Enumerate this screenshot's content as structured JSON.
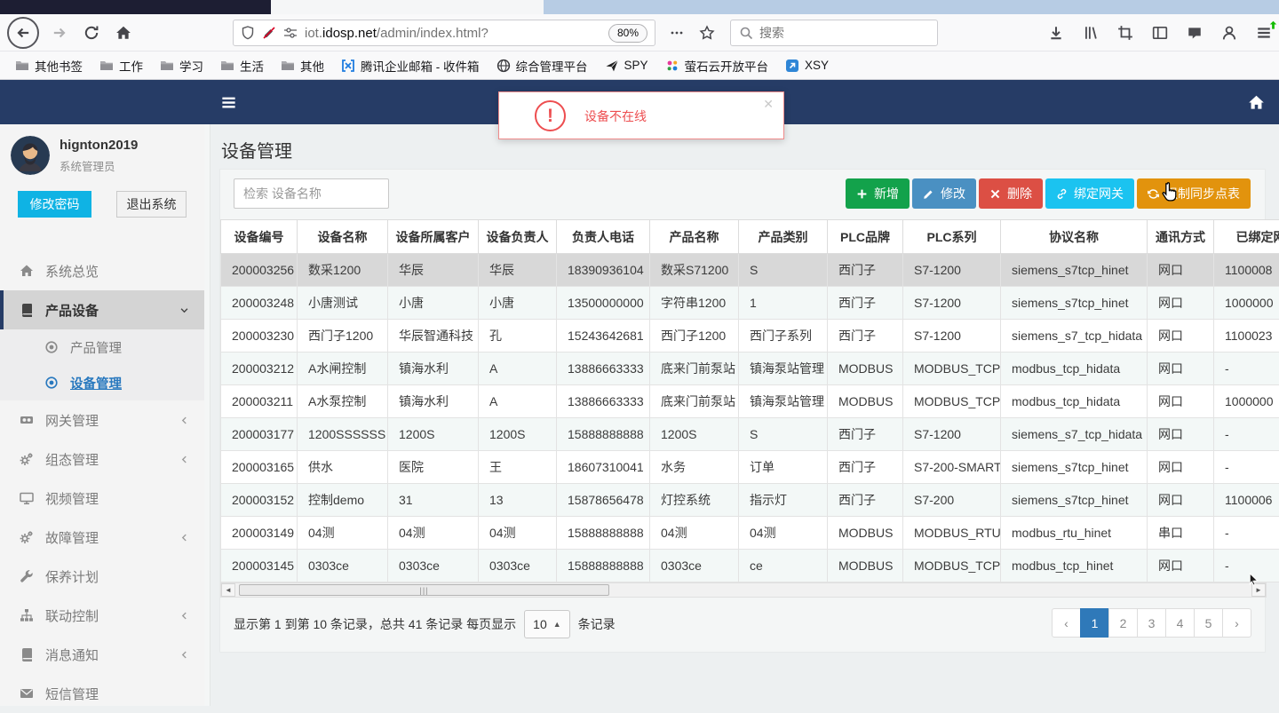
{
  "browser": {
    "toolbar": {
      "url_subdomain": "iot.",
      "url_domain": "idosp.net",
      "url_path": "/admin/index.html?",
      "zoom_badge": "80%",
      "search_placeholder": "搜索",
      "right_icons": [
        "download",
        "library",
        "screenshot",
        "sidebar",
        "pocket",
        "account",
        "menu"
      ]
    },
    "bookmarks": [
      {
        "icon": "folder",
        "label": "其他书签"
      },
      {
        "icon": "folder",
        "label": "工作"
      },
      {
        "icon": "folder",
        "label": "学习"
      },
      {
        "icon": "folder",
        "label": "生活"
      },
      {
        "icon": "folder",
        "label": "其他"
      },
      {
        "icon": "tencent-mail",
        "label": "腾讯企业邮箱 - 收件箱"
      },
      {
        "icon": "globe",
        "label": "综合管理平台"
      },
      {
        "icon": "plane",
        "label": "SPY"
      },
      {
        "icon": "color-dots",
        "label": "萤石云开放平台"
      },
      {
        "icon": "xsy",
        "label": "XSY"
      }
    ]
  },
  "app": {
    "alert": {
      "text": "设备不在线",
      "close": "✕",
      "accent_color": "#ED4E50"
    },
    "sidebar": {
      "user": {
        "name": "hignton2019",
        "role": "系统管理员"
      },
      "change_password": "修改密码",
      "logout": "退出系统",
      "menu": [
        {
          "icon": "home",
          "label": "系统总览"
        },
        {
          "icon": "book",
          "label": "产品设备",
          "chevron": "down",
          "active": true,
          "submenu": [
            {
              "icon": "dot-circle",
              "label": "产品管理"
            },
            {
              "icon": "dot-circle",
              "label": "设备管理",
              "active": true
            }
          ]
        },
        {
          "icon": "gateway",
          "label": "网关管理",
          "chevron": "left"
        },
        {
          "icon": "gears",
          "label": "组态管理",
          "chevron": "left"
        },
        {
          "icon": "monitor",
          "label": "视频管理"
        },
        {
          "icon": "gears",
          "label": "故障管理",
          "chevron": "left"
        },
        {
          "icon": "wrench",
          "label": "保养计划"
        },
        {
          "icon": "sitemap",
          "label": "联动控制",
          "chevron": "left"
        },
        {
          "icon": "book",
          "label": "消息通知",
          "chevron": "left"
        },
        {
          "icon": "envelope",
          "label": "短信管理"
        }
      ]
    },
    "main": {
      "title": "设备管理",
      "search_placeholder": "检索 设备名称",
      "actions": [
        {
          "name": "add",
          "icon": "plus",
          "label": "新增",
          "color": "#13A24B"
        },
        {
          "name": "edit",
          "icon": "pencil",
          "label": "修改",
          "color": "#4A90C2"
        },
        {
          "name": "delete",
          "icon": "x",
          "label": "删除",
          "color": "#DC4F44"
        },
        {
          "name": "bind-gateway",
          "icon": "link",
          "label": "绑定网关",
          "color": "#1BC3F0"
        },
        {
          "name": "force-sync",
          "icon": "refresh",
          "label": "强制同步点表",
          "color": "#E2930D"
        }
      ],
      "table": {
        "columns": [
          "设备编号",
          "设备名称",
          "设备所属客户",
          "设备负责人",
          "负责人电话",
          "产品名称",
          "产品类别",
          "PLC品牌",
          "PLC系列",
          "协议名称",
          "通讯方式",
          "已绑定网关"
        ],
        "selected_row": 0,
        "rows": [
          [
            "200003256",
            "数采1200",
            "华辰",
            "华辰",
            "18390936104",
            "数采S71200",
            "S",
            "西门子",
            "S7-1200",
            "siemens_s7tcp_hinet",
            "网口",
            "1100008"
          ],
          [
            "200003248",
            "小唐测试",
            "小唐",
            "小唐",
            "13500000000",
            "字符串1200",
            "1",
            "西门子",
            "S7-1200",
            "siemens_s7tcp_hinet",
            "网口",
            "1000000"
          ],
          [
            "200003230",
            "西门子1200",
            "华辰智通科技",
            "孔",
            "15243642681",
            "西门子1200",
            "西门子系列",
            "西门子",
            "S7-1200",
            "siemens_s7_tcp_hidata",
            "网口",
            "1100023"
          ],
          [
            "200003212",
            "A水闸控制",
            "镇海水利",
            "A",
            "13886663333",
            "底来门前泵站",
            "镇海泵站管理",
            "MODBUS",
            "MODBUS_TCP",
            "modbus_tcp_hidata",
            "网口",
            "-"
          ],
          [
            "200003211",
            "A水泵控制",
            "镇海水利",
            "A",
            "13886663333",
            "底来门前泵站",
            "镇海泵站管理",
            "MODBUS",
            "MODBUS_TCP",
            "modbus_tcp_hidata",
            "网口",
            "1000000"
          ],
          [
            "200003177",
            "1200SSSSSS",
            "1200S",
            "1200S",
            "15888888888",
            "1200S",
            "S",
            "西门子",
            "S7-1200",
            "siemens_s7_tcp_hidata",
            "网口",
            "-"
          ],
          [
            "200003165",
            "供水",
            "医院",
            "王",
            "18607310041",
            "水务",
            "订单",
            "西门子",
            "S7-200-SMART",
            "siemens_s7tcp_hinet",
            "网口",
            "-"
          ],
          [
            "200003152",
            "控制demo",
            "31",
            "13",
            "15878656478",
            "灯控系统",
            "指示灯",
            "西门子",
            "S7-200",
            "siemens_s7tcp_hinet",
            "网口",
            "1100006"
          ],
          [
            "200003149",
            "04测",
            "04测",
            "04测",
            "15888888888",
            "04测",
            "04测",
            "MODBUS",
            "MODBUS_RTU",
            "modbus_rtu_hinet",
            "串口",
            "-"
          ],
          [
            "200003145",
            "0303ce",
            "0303ce",
            "0303ce",
            "15888888888",
            "0303ce",
            "ce",
            "MODBUS",
            "MODBUS_TCP",
            "modbus_tcp_hinet",
            "网口",
            "-"
          ]
        ]
      },
      "pagination": {
        "info_before": "显示第 1 到第 10 条记录，总共 41 条记录 每页显示",
        "page_size": "10",
        "info_after": "条记录",
        "prev": "‹",
        "next": "›",
        "pages": [
          "1",
          "2",
          "3",
          "4",
          "5"
        ],
        "active_page": "1",
        "active_color": "#2F79B9"
      }
    }
  }
}
